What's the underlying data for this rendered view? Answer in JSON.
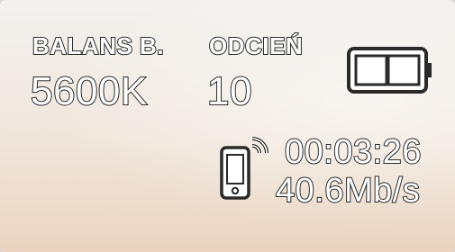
{
  "white_balance": {
    "label": "BALANS B.",
    "value": "5600K"
  },
  "tint": {
    "label": "ODCIEŃ",
    "value": "10"
  },
  "battery": {
    "icon": "battery-icon",
    "level": 0.5
  },
  "wireless": {
    "icon": "phone-wifi-icon",
    "timecode": "00:03:26",
    "bitrate": "40.6Mb/s"
  },
  "colors": {
    "text_fill": "#ffffff",
    "text_outline": "#2a2a2a"
  }
}
